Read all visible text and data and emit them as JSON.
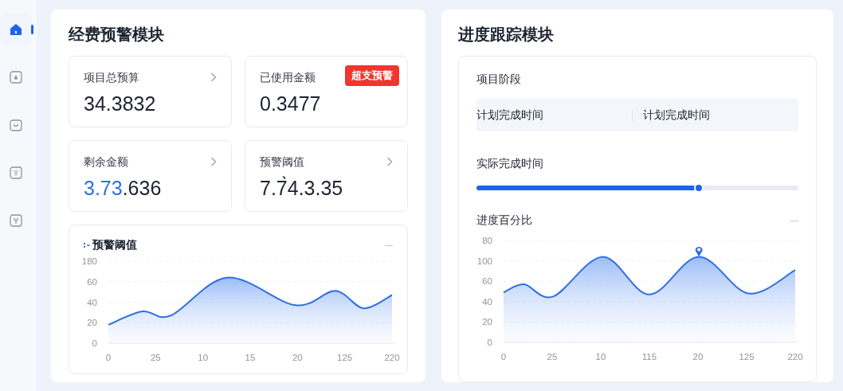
{
  "sidebar": {
    "items": [
      {
        "selected": true
      },
      {
        "selected": false
      },
      {
        "selected": false
      },
      {
        "selected": false
      },
      {
        "selected": false
      }
    ]
  },
  "budget": {
    "title": "经费预警模块",
    "cards": [
      {
        "label": "项目总预算",
        "value": "34.3832",
        "kind": "chevron"
      },
      {
        "label": "已使用金额",
        "value": "0.3477",
        "kind": "badge",
        "badge": "超支预警"
      },
      {
        "label": "剩余金额",
        "value_accent": "3.73",
        "value": ".636",
        "kind": "chevron"
      },
      {
        "label": "预警阈值",
        "value": "7.7̀4.3.35",
        "kind": "chevron"
      }
    ],
    "chart": {
      "title": "预警阈值",
      "menu": "—",
      "kind": "picture",
      "y_labels": [
        "180",
        "60",
        "40",
        "20",
        "0"
      ],
      "x_labels": [
        "0",
        "25",
        "10",
        "15",
        "20",
        "125",
        "220"
      ]
    }
  },
  "progress": {
    "title": "进度跟踪模块",
    "stage": {
      "label": "项目阶段",
      "planned": [
        "计划完成时间",
        "计划完成时间"
      ]
    },
    "actual": {
      "label": "实际完成时间",
      "level": 0.69
    },
    "chart": {
      "title": "进度百分比",
      "menu": "—",
      "kind": "picture",
      "marker": true,
      "y_labels": [
        "80",
        "100",
        "60",
        "40",
        "20",
        "0"
      ],
      "x_labels": [
        "0",
        "25",
        "10",
        "115",
        "20",
        "125",
        "220"
      ]
    }
  }
}
